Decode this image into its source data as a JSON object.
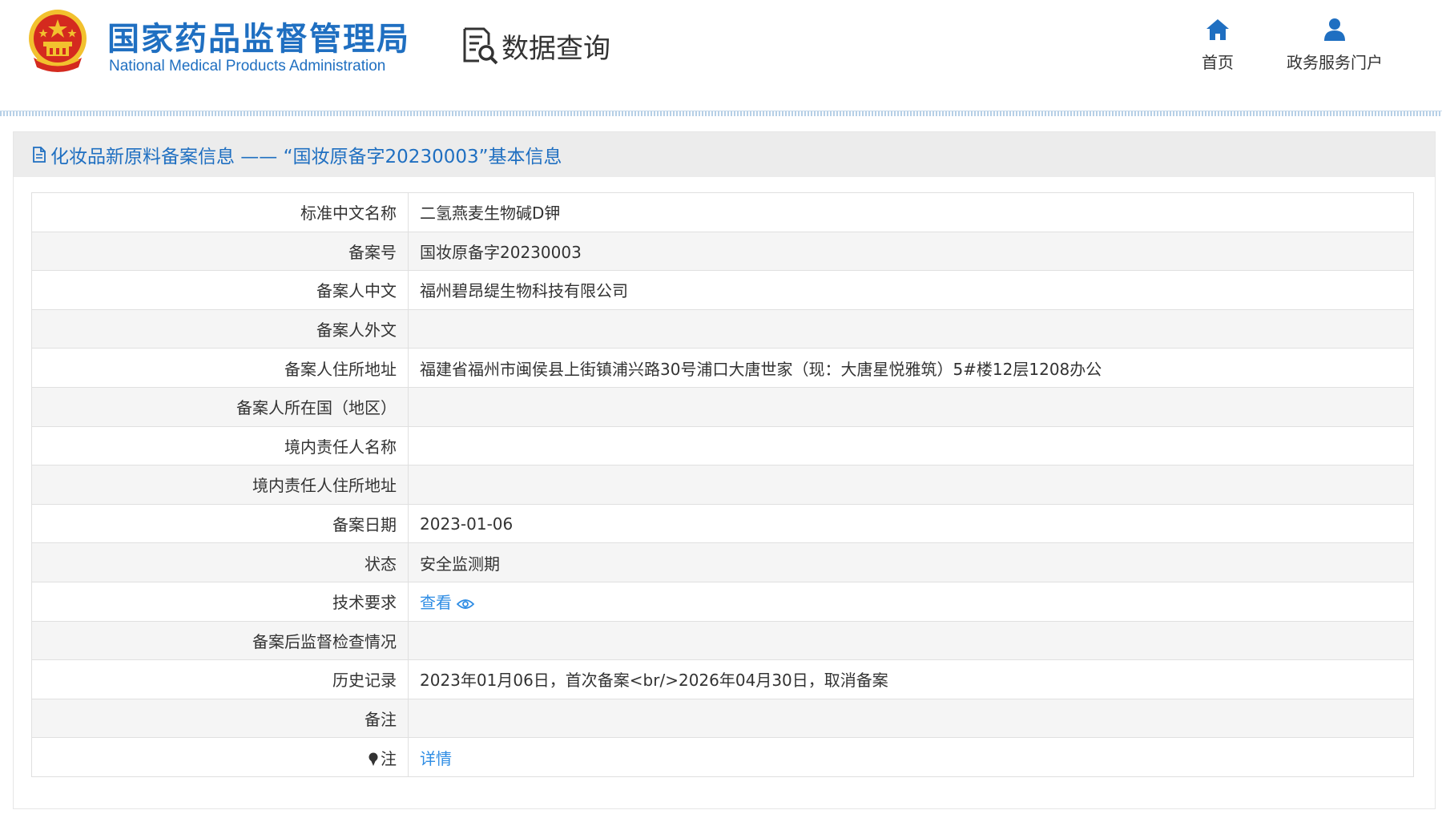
{
  "header": {
    "logo_cn": "国家药品监督管理局",
    "logo_en": "National Medical Products Administration",
    "query_label": "数据查询",
    "nav": {
      "home_label": "首页",
      "portal_label": "政务服务门户"
    }
  },
  "panel": {
    "title": "化妆品新原料备案信息 —— “国妆原备字20230003”基本信息"
  },
  "rows": [
    {
      "label": "标准中文名称",
      "value": "二氢燕麦生物碱D钾"
    },
    {
      "label": "备案号",
      "value": "国妆原备字20230003"
    },
    {
      "label": "备案人中文",
      "value": "福州碧昂缇生物科技有限公司"
    },
    {
      "label": "备案人外文",
      "value": ""
    },
    {
      "label": "备案人住所地址",
      "value": "福建省福州市闽侯县上街镇浦兴路30号浦口大唐世家（现：大唐星悦雅筑）5#楼12层1208办公"
    },
    {
      "label": "备案人所在国（地区）",
      "value": ""
    },
    {
      "label": "境内责任人名称",
      "value": ""
    },
    {
      "label": "境内责任人住所地址",
      "value": ""
    },
    {
      "label": "备案日期",
      "value": "2023-01-06"
    },
    {
      "label": "状态",
      "value": "安全监测期"
    },
    {
      "label": "技术要求",
      "value": "查看"
    },
    {
      "label": "备案后监督检查情况",
      "value": ""
    },
    {
      "label": "历史记录",
      "value": "2023年01月06日，首次备案<br/>2026年04月30日，取消备案"
    },
    {
      "label": "备注",
      "value": ""
    },
    {
      "label": "注",
      "value": "详情"
    }
  ],
  "colors": {
    "brand_blue": "#1f6fc1",
    "link_blue": "#2f8de4",
    "emblem_red": "#d42a1f",
    "emblem_gold": "#f2c12e"
  },
  "icons": {
    "emblem": "national-emblem-icon",
    "query": "document-search-icon",
    "home": "home-icon",
    "portal": "user-icon",
    "title": "document-icon",
    "view": "eye-icon",
    "note": "pin-icon"
  }
}
